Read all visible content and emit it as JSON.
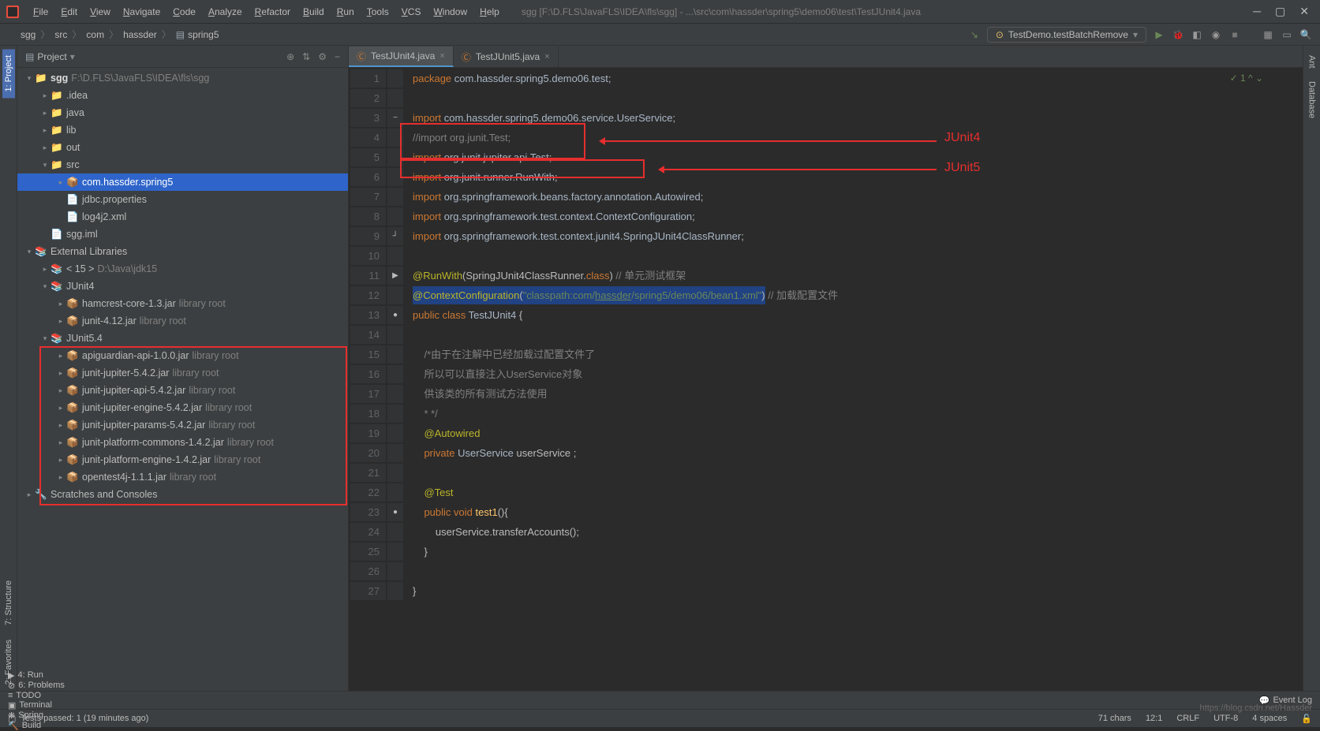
{
  "menubar": {
    "items": [
      "File",
      "Edit",
      "View",
      "Navigate",
      "Code",
      "Analyze",
      "Refactor",
      "Build",
      "Run",
      "Tools",
      "VCS",
      "Window",
      "Help"
    ]
  },
  "window_title": "sgg [F:\\D.FLS\\JavaFLS\\IDEA\\fls\\sgg] - ...\\src\\com\\hassder\\spring5\\demo06\\test\\TestJUnit4.java",
  "breadcrumbs": [
    "sgg",
    "src",
    "com",
    "hassder",
    "spring5"
  ],
  "run_config": "TestDemo.testBatchRemove",
  "project_panel": {
    "title": "Project"
  },
  "tree": [
    {
      "d": 0,
      "a": "▾",
      "i": "📁",
      "t": "sgg",
      "dim": "F:\\D.FLS\\JavaFLS\\IDEA\\fls\\sgg",
      "bold": true
    },
    {
      "d": 1,
      "a": "▸",
      "i": "📁",
      "t": ".idea"
    },
    {
      "d": 1,
      "a": "▸",
      "i": "📁",
      "t": "java"
    },
    {
      "d": 1,
      "a": "▸",
      "i": "📁",
      "t": "lib"
    },
    {
      "d": 1,
      "a": "▸",
      "i": "📁",
      "t": "out",
      "c": "#cc7832"
    },
    {
      "d": 1,
      "a": "▾",
      "i": "📁",
      "t": "src",
      "c": "#4e94ce"
    },
    {
      "d": 2,
      "a": "▸",
      "i": "📦",
      "t": "com.hassder.spring5",
      "sel": true
    },
    {
      "d": 2,
      "a": "",
      "i": "📄",
      "t": "jdbc.properties"
    },
    {
      "d": 2,
      "a": "",
      "i": "📄",
      "t": "log4j2.xml"
    },
    {
      "d": 1,
      "a": "",
      "i": "📄",
      "t": "sgg.iml"
    },
    {
      "d": 0,
      "a": "▾",
      "i": "📚",
      "t": "External Libraries"
    },
    {
      "d": 1,
      "a": "▸",
      "i": "📚",
      "t": "< 15 >",
      "dim": "D:\\Java\\jdk15"
    },
    {
      "d": 1,
      "a": "▾",
      "i": "📚",
      "t": "JUnit4"
    },
    {
      "d": 2,
      "a": "▸",
      "i": "📦",
      "t": "hamcrest-core-1.3.jar",
      "dim": "library root"
    },
    {
      "d": 2,
      "a": "▸",
      "i": "📦",
      "t": "junit-4.12.jar",
      "dim": "library root"
    },
    {
      "d": 1,
      "a": "▾",
      "i": "📚",
      "t": "JUnit5.4"
    },
    {
      "d": 2,
      "a": "▸",
      "i": "📦",
      "t": "apiguardian-api-1.0.0.jar",
      "dim": "library root"
    },
    {
      "d": 2,
      "a": "▸",
      "i": "📦",
      "t": "junit-jupiter-5.4.2.jar",
      "dim": "library root"
    },
    {
      "d": 2,
      "a": "▸",
      "i": "📦",
      "t": "junit-jupiter-api-5.4.2.jar",
      "dim": "library root"
    },
    {
      "d": 2,
      "a": "▸",
      "i": "📦",
      "t": "junit-jupiter-engine-5.4.2.jar",
      "dim": "library root"
    },
    {
      "d": 2,
      "a": "▸",
      "i": "📦",
      "t": "junit-jupiter-params-5.4.2.jar",
      "dim": "library root"
    },
    {
      "d": 2,
      "a": "▸",
      "i": "📦",
      "t": "junit-platform-commons-1.4.2.jar",
      "dim": "library root"
    },
    {
      "d": 2,
      "a": "▸",
      "i": "📦",
      "t": "junit-platform-engine-1.4.2.jar",
      "dim": "library root"
    },
    {
      "d": 2,
      "a": "▸",
      "i": "📦",
      "t": "opentest4j-1.1.1.jar",
      "dim": "library root"
    },
    {
      "d": 0,
      "a": "▸",
      "i": "🔧",
      "t": "Scratches and Consoles"
    }
  ],
  "editor_tabs": [
    {
      "label": "TestJUnit4.java",
      "active": true
    },
    {
      "label": "TestJUnit5.java",
      "active": false
    }
  ],
  "code_lines": [
    {
      "n": 1,
      "html": "<span class='kw'>package</span> <span class='pkg'>com.hassder.spring5.demo06.test;</span>"
    },
    {
      "n": 2,
      "html": ""
    },
    {
      "n": 3,
      "html": "<span class='kw'>import</span> <span class='pkg'>com.hassder.spring5.demo06.service.UserService;</span>",
      "m": "−"
    },
    {
      "n": 4,
      "html": "<span class='cmt'>//import org.junit.Test;</span>"
    },
    {
      "n": 5,
      "html": "<span class='kw'>import</span> <span class='pkg'>org.junit.jupiter.api.</span><span class='cls'>Test</span>;"
    },
    {
      "n": 6,
      "html": "<span class='kw'>import</span> <span class='pkg'>org.junit.runner.</span><span class='cls'>RunWith</span>;"
    },
    {
      "n": 7,
      "html": "<span class='kw'>import</span> <span class='pkg'>org.springframework.beans.factory.annotation.</span><span class='cls'>Autowired</span>;"
    },
    {
      "n": 8,
      "html": "<span class='kw'>import</span> <span class='pkg'>org.springframework.test.context.</span><span class='cls'>ContextConfiguration</span>;"
    },
    {
      "n": 9,
      "html": "<span class='kw'>import</span> <span class='pkg'>org.springframework.test.context.junit4.</span><span class='cls'>SpringJUnit4ClassRunner</span>;",
      "m": "┘"
    },
    {
      "n": 10,
      "html": ""
    },
    {
      "n": 11,
      "html": "<span class='ann'>@RunWith</span>(SpringJUnit4ClassRunner.<span class='kw'>class</span>) <span class='cmt'>// 单元测试框架</span>",
      "m": "▶"
    },
    {
      "n": 12,
      "html": "<span class='hl-line'><span class='ann'>@ContextConfiguration</span>(<span class='str'>\"classpath:com/<u>hassder</u>/spring5/demo06/bean1.xml\"</span>)</span> <span class='cmt'>// 加载配置文件</span>"
    },
    {
      "n": 13,
      "html": "<span class='kw'>public class</span> <span class='cls'>TestJUnit4</span> {",
      "m": "●"
    },
    {
      "n": 14,
      "html": ""
    },
    {
      "n": 15,
      "html": "    <span class='cmt'>/*由于在注解中已经加载过配置文件了</span>"
    },
    {
      "n": 16,
      "html": "    <span class='cmt'>所以可以直接注入UserService对象</span>"
    },
    {
      "n": 17,
      "html": "    <span class='cmt'>供该类的所有测试方法使用</span>"
    },
    {
      "n": 18,
      "html": "    <span class='cmt'>* */</span>"
    },
    {
      "n": 19,
      "html": "    <span class='ann'>@Autowired</span>"
    },
    {
      "n": 20,
      "html": "    <span class='kw'>private</span> <span class='cls'>UserService</span> userService ;"
    },
    {
      "n": 21,
      "html": ""
    },
    {
      "n": 22,
      "html": "    <span class='ann'>@Test</span>"
    },
    {
      "n": 23,
      "html": "    <span class='kw'>public void</span> <span class='fn'>test1</span>(){",
      "m": "●"
    },
    {
      "n": 24,
      "html": "        userService.transferAccounts();"
    },
    {
      "n": 25,
      "html": "    }"
    },
    {
      "n": 26,
      "html": ""
    },
    {
      "n": 27,
      "html": "}"
    }
  ],
  "annotations": {
    "junit4": "JUnit4",
    "junit5": "JUnit5"
  },
  "inspection": "✓ 1  ^  ⌄",
  "left_tabs": [
    "1: Project",
    "7: Structure",
    "2: Favorites"
  ],
  "right_tabs": [
    "Ant",
    "Database"
  ],
  "bottom_tools": [
    {
      "icon": "▶",
      "label": "4: Run"
    },
    {
      "icon": "⊘",
      "label": "6: Problems"
    },
    {
      "icon": "≡",
      "label": "TODO"
    },
    {
      "icon": "▣",
      "label": "Terminal"
    },
    {
      "icon": "❋",
      "label": "Spring"
    },
    {
      "icon": "🔨",
      "label": "Build"
    }
  ],
  "event_log": "Event Log",
  "status": {
    "msg": "Tests passed: 1 (19 minutes ago)",
    "chars": "71 chars",
    "pos": "12:1",
    "enc": "CRLF",
    "charset": "UTF-8",
    "indent": "4 spaces",
    "lock": "🔓"
  },
  "watermark": "https://blog.csdn.net/Hassder"
}
